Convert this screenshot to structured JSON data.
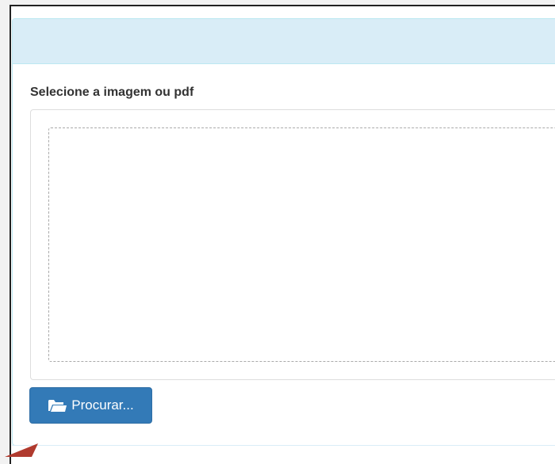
{
  "upload": {
    "label": "Selecione a imagem ou pdf",
    "browse_button_label": "Procurar...",
    "browse_icon": "folder-open-icon"
  },
  "colors": {
    "panel_heading": "#d9edf7",
    "panel_border": "#bce8f1",
    "button_primary": "#337ab7",
    "cursor_arrow": "#b03a2e"
  }
}
